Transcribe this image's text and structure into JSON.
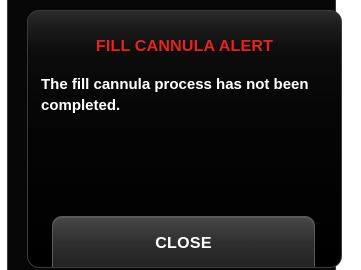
{
  "alert": {
    "title": "FILL CANNULA ALERT",
    "message": "The fill cannula process has not been completed.",
    "close_label": "CLOSE"
  },
  "colors": {
    "title": "#e8231c",
    "text": "#ffffff",
    "background": "#000000"
  }
}
